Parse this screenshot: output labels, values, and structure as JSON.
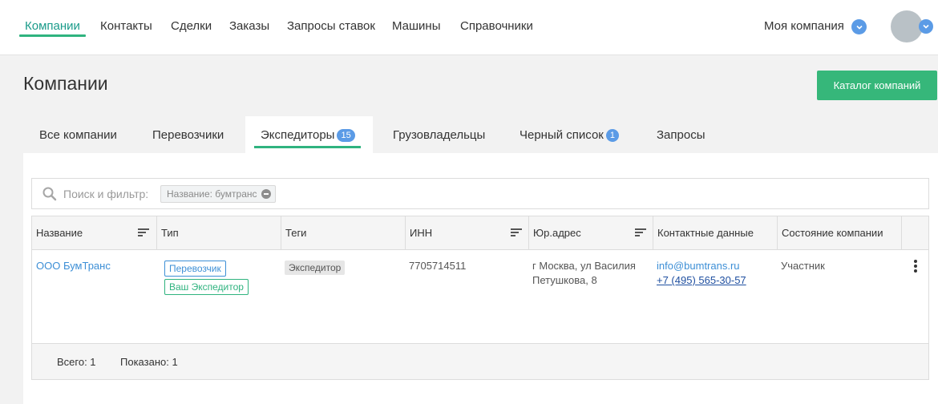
{
  "nav": {
    "items": [
      {
        "label": "Компании",
        "active": true
      },
      {
        "label": "Контакты"
      },
      {
        "label": "Сделки"
      },
      {
        "label": "Заказы"
      },
      {
        "label": "Запросы ставок"
      },
      {
        "label": "Машины"
      },
      {
        "label": "Справочники"
      }
    ],
    "company_selector": "Моя компания"
  },
  "page": {
    "title": "Компании",
    "catalog_button": "Каталог компаний"
  },
  "tabs": [
    {
      "label": "Все компании"
    },
    {
      "label": "Перевозчики"
    },
    {
      "label": "Экспедиторы",
      "badge": "15",
      "active": true
    },
    {
      "label": "Грузовладельцы"
    },
    {
      "label": "Черный список",
      "badge": "1"
    },
    {
      "label": "Запросы"
    }
  ],
  "search": {
    "placeholder": "Поиск и фильтр:",
    "filter_chip": "Название: бумтранс"
  },
  "table": {
    "columns": [
      "Название",
      "Тип",
      "Теги",
      "ИНН",
      "Юр.адрес",
      "Контактные данные",
      "Состояние компании"
    ],
    "rows": [
      {
        "name": "ООО БумТранс",
        "types": [
          "Перевозчик",
          "Ваш Экспедитор"
        ],
        "tags": [
          "Экспедитор"
        ],
        "inn": "7705714511",
        "address_line1": "г Москва, ул Василия",
        "address_line2": "Петушкова, 8",
        "email": "info@bumtrans.ru",
        "phone": "+7 (495) 565-30-57",
        "status": "Участник"
      }
    ],
    "footer": {
      "total": "Всего: 1",
      "shown": "Показано: 1"
    }
  },
  "colors": {
    "accent_green": "#2fb37f",
    "button_green": "#36b77a",
    "badge_blue": "#5b9be6",
    "link_blue": "#3d8fd6",
    "active_nav": "#1a9b8a"
  }
}
